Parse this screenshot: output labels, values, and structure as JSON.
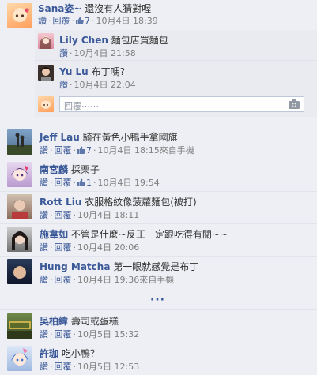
{
  "comments": [
    {
      "name": "Sana",
      "name_suffix": "姿~",
      "text": "還沒有人猜對喔",
      "like": "讚",
      "reply": "回覆",
      "likes": "7",
      "time": "10月4日 18:39"
    }
  ],
  "replies": [
    {
      "name": "Lily Chen",
      "text": "麵包店買麵包",
      "like": "讚",
      "time": "10月4日 21:58"
    },
    {
      "name": "Yu Lu",
      "text": "布丁嗎?",
      "like": "讚",
      "time": "10月4日 22:04"
    }
  ],
  "reply_input": {
    "placeholder": "回覆⋯⋯"
  },
  "top_level": [
    {
      "name": "Jeff Lau",
      "text": "騎在黃色小鴨手拿國旗",
      "like": "讚",
      "reply": "回覆",
      "likes": "7",
      "time": "10月4日 18:15",
      "source": "來自手機"
    },
    {
      "name": "南宮麟",
      "text": "採栗子",
      "like": "讚",
      "reply": "回覆",
      "likes": "1",
      "time": "10月4日 19:54"
    },
    {
      "name": "Rott Liu",
      "text": "衣服格紋像菠蘿麵包(被打)",
      "like": "讚",
      "reply": "回覆",
      "time": "10月4日 18:11"
    },
    {
      "name": "施韋如",
      "text": "不管是什麼~反正一定跟吃得有關~~",
      "like": "讚",
      "reply": "回覆",
      "time": "10月4日 20:06"
    },
    {
      "name": "Hung Matcha",
      "text": "第一眼就感覺是布丁",
      "like": "讚",
      "reply": "回覆",
      "time": "10月4日 19:36",
      "source": "來自手機"
    },
    {
      "name": "吳柏緯",
      "text": "壽司或蛋糕",
      "like": "讚",
      "reply": "回覆",
      "time": "10月5日 15:32"
    },
    {
      "name": "許珈",
      "text": "吃小鴨？",
      "like": "讚",
      "reply": "回覆",
      "time": "10月5日 12:53"
    }
  ],
  "more_label": "···",
  "colors": {
    "link": "#3b5998",
    "background": "#edeff4",
    "meta": "#7f7f7f"
  },
  "icons": {
    "like": "thumbs-up-icon",
    "camera": "camera-icon"
  }
}
